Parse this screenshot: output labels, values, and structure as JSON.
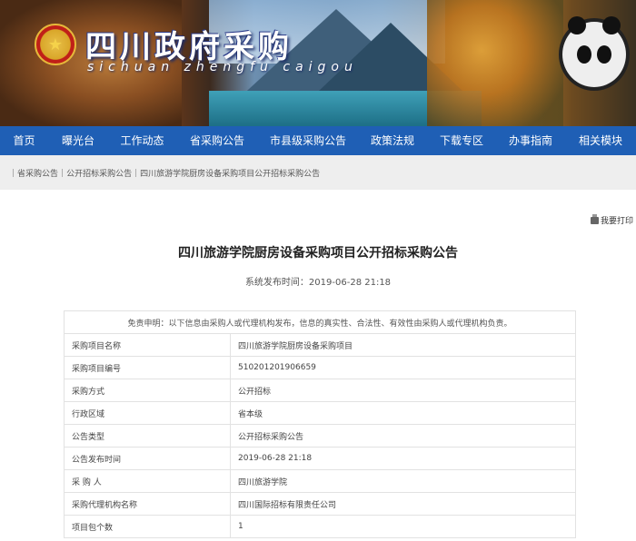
{
  "header": {
    "site_title": "四川政府采购",
    "site_subtitle": "sichuan  zhengfu  caigou",
    "emblem_icon": "national-emblem-icon"
  },
  "nav": {
    "items": [
      {
        "label": "首页"
      },
      {
        "label": "曝光台"
      },
      {
        "label": "工作动态"
      },
      {
        "label": "省采购公告"
      },
      {
        "label": "市县级采购公告"
      },
      {
        "label": "政策法规"
      },
      {
        "label": "下载专区"
      },
      {
        "label": "办事指南"
      },
      {
        "label": "相关模块"
      }
    ],
    "background_color": "#1f5fb5"
  },
  "breadcrumb": {
    "items": [
      "省采购公告",
      "公开招标采购公告",
      "四川旅游学院厨房设备采购项目公开招标采购公告"
    ]
  },
  "print_label": "我要打印",
  "article": {
    "title": "四川旅游学院厨房设备采购项目公开招标采购公告",
    "publish_time": "系统发布时间：2019-06-28 21:18"
  },
  "info_table": {
    "disclaimer": "免责申明：以下信息由采购人或代理机构发布，信息的真实性、合法性、有效性由采购人或代理机构负责。",
    "rows": [
      {
        "key": "采购项目名称",
        "value": "四川旅游学院厨房设备采购项目"
      },
      {
        "key": "采购项目编号",
        "value": "510201201906659"
      },
      {
        "key": "采购方式",
        "value": "公开招标"
      },
      {
        "key": "行政区域",
        "value": "省本级"
      },
      {
        "key": "公告类型",
        "value": "公开招标采购公告"
      },
      {
        "key": "公告发布时间",
        "value": "2019-06-28 21:18"
      },
      {
        "key": "采 购 人",
        "value": "四川旅游学院"
      },
      {
        "key": "采购代理机构名称",
        "value": "四川国际招标有限责任公司"
      },
      {
        "key": "项目包个数",
        "value": "1"
      }
    ]
  }
}
